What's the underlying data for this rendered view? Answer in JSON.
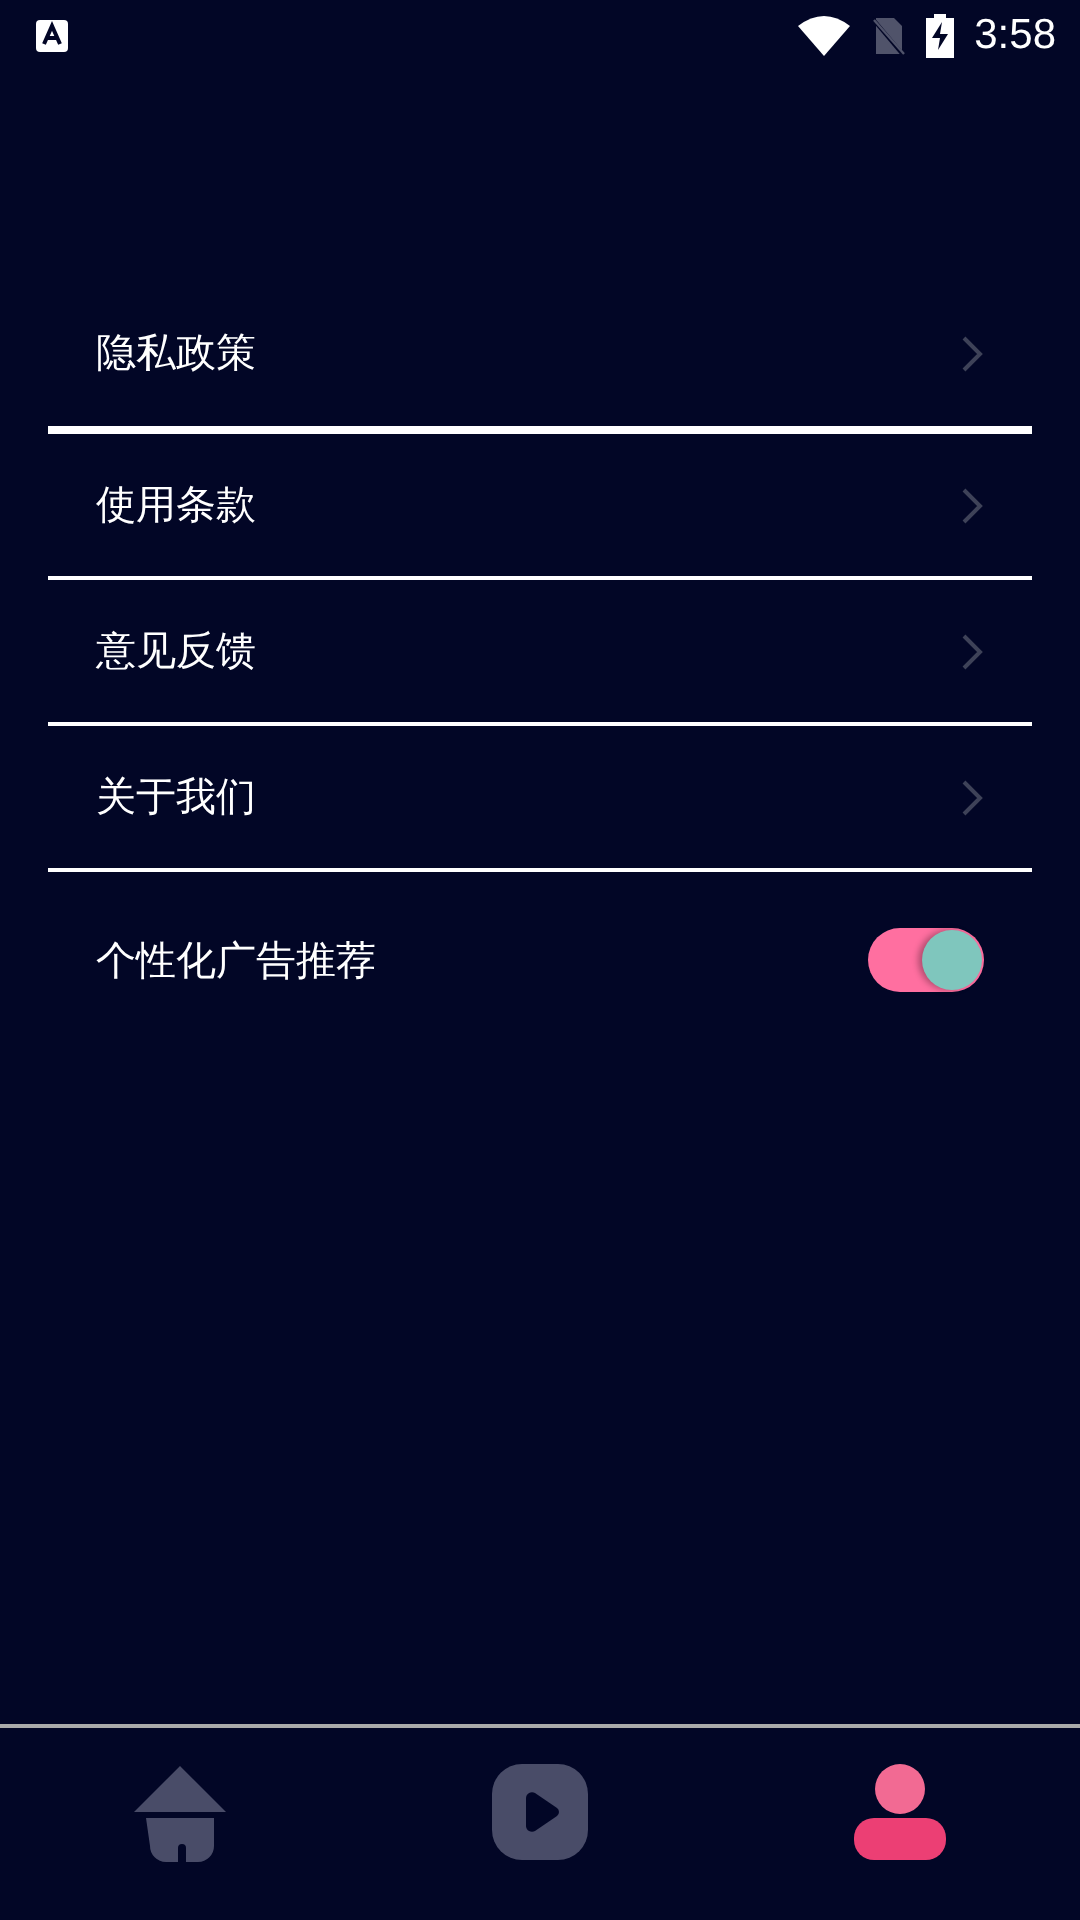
{
  "status_bar": {
    "time": "3:58"
  },
  "settings": [
    {
      "kind": "link",
      "label": "隐私政策"
    },
    {
      "kind": "link",
      "label": "使用条款"
    },
    {
      "kind": "link",
      "label": "意见反馈"
    },
    {
      "kind": "link",
      "label": "关于我们"
    },
    {
      "kind": "toggle",
      "label": "个性化广告推荐",
      "on": true
    }
  ],
  "bottom_nav": [
    {
      "kind": "home",
      "selected": false
    },
    {
      "kind": "play",
      "selected": false
    },
    {
      "kind": "profile",
      "selected": true
    }
  ]
}
